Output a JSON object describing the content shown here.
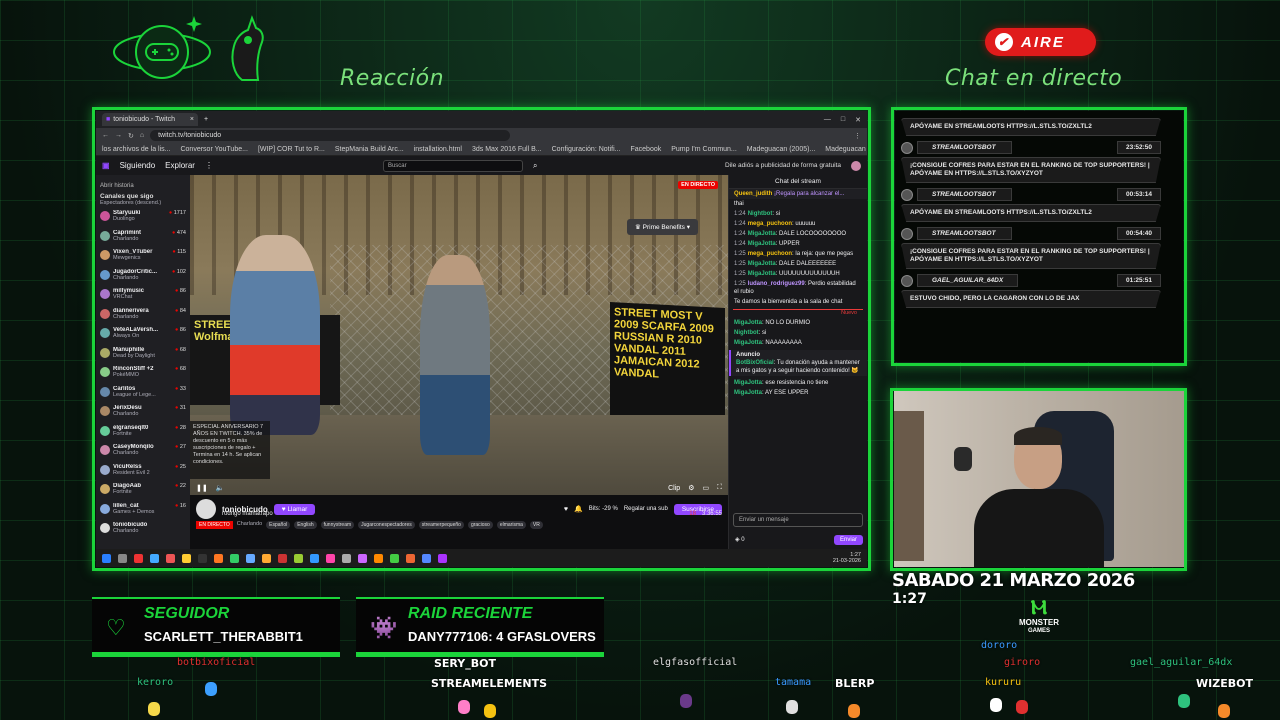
{
  "overlay": {
    "left_heading": "Reacción",
    "right_heading": "Chat en directo",
    "live_badge": "AIRE",
    "datetime": {
      "date": "SABADO 21 MARZO 2026",
      "time": "1:27"
    },
    "sponsor": {
      "line1": "MONSTER",
      "line2": "GAMES"
    },
    "accent_color": "#1bd43a"
  },
  "alerts": {
    "follower": {
      "title": "SEGUIDOR",
      "value": "SCARLETT_THERABBIT1",
      "icon": "heart-icon"
    },
    "raid": {
      "title": "RAID RECIENTE",
      "value": "DANY777106: 4 GFASLOVERS",
      "icon": "invader-icon"
    }
  },
  "browser": {
    "tab_title": "toniobicudo - Twitch",
    "url": "twitch.tv/toniobicudo",
    "bookmarks": [
      "los archivos de la lis...",
      "Conversor YouTube...",
      "[WIP] COR Tut to R...",
      "StepMania Build Arc...",
      "installation.html",
      "3ds Max 2016 Full B...",
      "Configuración: Notifi...",
      "Facebook",
      "Pump I'm Commun...",
      "Madeguacan (2005)...",
      "Madeguacan (2005)...",
      "Step Converter | ascii..."
    ]
  },
  "twitch": {
    "nav_following": "Siguiendo",
    "nav_browse": "Explorar",
    "search_placeholder": "Buscar",
    "adfree": "Dile adiós a publicidad de forma gratuita",
    "sidebar_history": "Abrir historia",
    "sidebar_title": "Canales que sigo",
    "sidebar_sort": "Espectadores (descend.)",
    "channels": [
      {
        "name": "Staryuuki",
        "game": "Duolingo",
        "viewers": "1717"
      },
      {
        "name": "Caprimint",
        "game": "Charlando",
        "viewers": "474"
      },
      {
        "name": "Vixen_VTuber",
        "game": "Mewgenics",
        "viewers": "115"
      },
      {
        "name": "JugadorCritic...",
        "game": "Charlando",
        "viewers": "102"
      },
      {
        "name": "millymusic",
        "game": "VRChat",
        "viewers": "86"
      },
      {
        "name": "diannerivera",
        "game": "Charlando",
        "viewers": "84"
      },
      {
        "name": "VeteALaVersh...",
        "game": "Always On",
        "viewers": "86"
      },
      {
        "name": "Manuphille",
        "game": "Dead by Daylight",
        "viewers": "68"
      },
      {
        "name": "RinconStiff +2",
        "game": "PokéMMO",
        "viewers": "68"
      },
      {
        "name": "Carlitos",
        "game": "League of Lege...",
        "viewers": "33"
      },
      {
        "name": "JerixDesu",
        "game": "Charlando",
        "viewers": "31"
      },
      {
        "name": "elgranseqlt0",
        "game": "Fortnite",
        "viewers": "28"
      },
      {
        "name": "CaseyMonqilo",
        "game": "Charlando",
        "viewers": "27"
      },
      {
        "name": "VicuRelss",
        "game": "Resident Evil 2",
        "viewers": "25"
      },
      {
        "name": "DiagoAab",
        "game": "Fortnite",
        "viewers": "22"
      },
      {
        "name": "lillen_cat",
        "game": "Games + Demos",
        "viewers": "16"
      },
      {
        "name": "toniobicudo",
        "game": "Charlando",
        "viewers": ""
      }
    ],
    "video": {
      "live_label": "EN DIRECTO",
      "prime": "Prime Benefits",
      "banner_text": "STREET MOST V 2009 SCARFA 2009 RUSSIAN R 2010 VANDAL 2011 JAMAICAN 2012 VANDAL",
      "left_sign": "STREET WOLVERINE Wolfman",
      "promo": "ESPECIAL ANIVERSARIO 7 AÑOS EN TWITCH. 35% de descuento en 5 o más suscripciones de regalo + Termina en 14 h. Se aplican condiciones.",
      "clip": "Clip"
    },
    "channel": {
      "name": "toniobicudo",
      "title": "rodrigo mamatrapo",
      "live": "EN DIRECTO",
      "category": "Charlando",
      "follow": "Llamar",
      "bits": "Bits: -29 %",
      "gift": "Regalar una sub",
      "subscribe": "Suscribirse",
      "viewers": "18",
      "uptime": "3:36:55",
      "tags": [
        "Español",
        "English",
        "funnystream",
        "Jugarconespectadores",
        "streamerpequeño",
        "gracioso",
        "elmarisma",
        "VR"
      ]
    },
    "chat": {
      "title": "Chat del stream",
      "pinned_user": "Queen_judith",
      "pinned_text": "¡Regala para alcanzar el...",
      "messages": [
        {
          "time": "",
          "user": "",
          "text": "thai"
        },
        {
          "time": "1:24",
          "user": "Nightbot",
          "text": "si"
        },
        {
          "time": "1:24",
          "user": "mega_puchoon",
          "text": "uuuuuu"
        },
        {
          "time": "1:24",
          "user": "MigaJotta",
          "text": "DALE LOCOOOOOOOO"
        },
        {
          "time": "1:24",
          "user": "MigaJotta",
          "text": "UPPER"
        },
        {
          "time": "1:25",
          "user": "mega_puchoon",
          "text": "la reja: que me pegas"
        },
        {
          "time": "1:25",
          "user": "MigaJotta",
          "text": "DALE DALEEEEEEE"
        },
        {
          "time": "1:25",
          "user": "MigaJotta",
          "text": "UUUUUUUUUUUUUH"
        },
        {
          "time": "1:25",
          "user": "ludano_rodriguez99",
          "text": "Perdio estabilidad el rubio"
        },
        {
          "time": "",
          "user": "",
          "text": "Te damos la bienvenida a la sala de chat"
        }
      ],
      "new_label": "Nuevo",
      "messages2": [
        {
          "time": "",
          "user": "MigaJotta",
          "text": "NO LO DURMIO"
        },
        {
          "time": "",
          "user": "Nightbot",
          "text": "si"
        },
        {
          "time": "",
          "user": "MigaJotta",
          "text": "NAAAAAAAA"
        }
      ],
      "announcement_label": "Anuncio",
      "announcement": "Tu donación ayuda a mantener a mis gatos y a seguir haciendo contenido! 🐱",
      "announcement_user": "BotBixOficial",
      "messages3": [
        {
          "time": "",
          "user": "MigaJotta",
          "text": "ese resistencia no tiene"
        },
        {
          "time": "",
          "user": "MigaJotta",
          "text": "AY ESE UPPER"
        }
      ],
      "input_placeholder": "Enviar un mensaje",
      "send": "Enviar",
      "points": "0"
    }
  },
  "taskbar": {
    "time": "1:27",
    "date": "21-03-2026"
  },
  "live_chat": {
    "items": [
      {
        "type": "msg",
        "text": "APÓYAME EN STREAMLOOTS HTTPS://L.STLS.TO/ZXLTL2"
      },
      {
        "type": "user",
        "name": "STREAMLOOTSBOT",
        "time": "23:52:50"
      },
      {
        "type": "msg",
        "text": "¡CONSIGUE COFRES PARA ESTAR EN EL RANKING DE TOP SUPPORTERS! | APÓYAME EN HTTPS://L.STLS.TO/XYZYOT"
      },
      {
        "type": "user",
        "name": "STREAMLOOTSBOT",
        "time": "00:53:14"
      },
      {
        "type": "msg",
        "text": "APÓYAME EN STREAMLOOTS HTTPS://L.STLS.TO/ZXLTL2"
      },
      {
        "type": "user",
        "name": "STREAMLOOTSBOT",
        "time": "00:54:40"
      },
      {
        "type": "msg",
        "text": "¡CONSIGUE COFRES PARA ESTAR EN EL RANKING DE TOP SUPPORTERS! | APÓYAME EN HTTPS://L.STLS.TO/XYZYOT"
      },
      {
        "type": "user",
        "name": "GAEL_AGUILAR_64DX",
        "time": "01:25:51"
      },
      {
        "type": "msg",
        "text": "ESTUVO CHIDO, PERO LA CAGARON CON LO DE JAX"
      }
    ]
  },
  "stream_avatars": [
    {
      "name": "botbixoficial",
      "color": "#e03030"
    },
    {
      "name": "keroro",
      "color": "#2ec27e"
    },
    {
      "name": "SERY_BOT",
      "color": "#ffffff"
    },
    {
      "name": "STREAMELEMENTS",
      "color": "#ffffff"
    },
    {
      "name": "elgfasofficial",
      "color": "#e0e0e0"
    },
    {
      "name": "tamama",
      "color": "#3a9bff"
    },
    {
      "name": "BLERP",
      "color": "#ffffff"
    },
    {
      "name": "dororo",
      "color": "#3a9bff"
    },
    {
      "name": "giroro",
      "color": "#e03030"
    },
    {
      "name": "kururu",
      "color": "#f5c211"
    },
    {
      "name": "gael_aguilar_64dx",
      "color": "#2ec27e"
    },
    {
      "name": "WIZEBOT",
      "color": "#ffffff"
    }
  ]
}
